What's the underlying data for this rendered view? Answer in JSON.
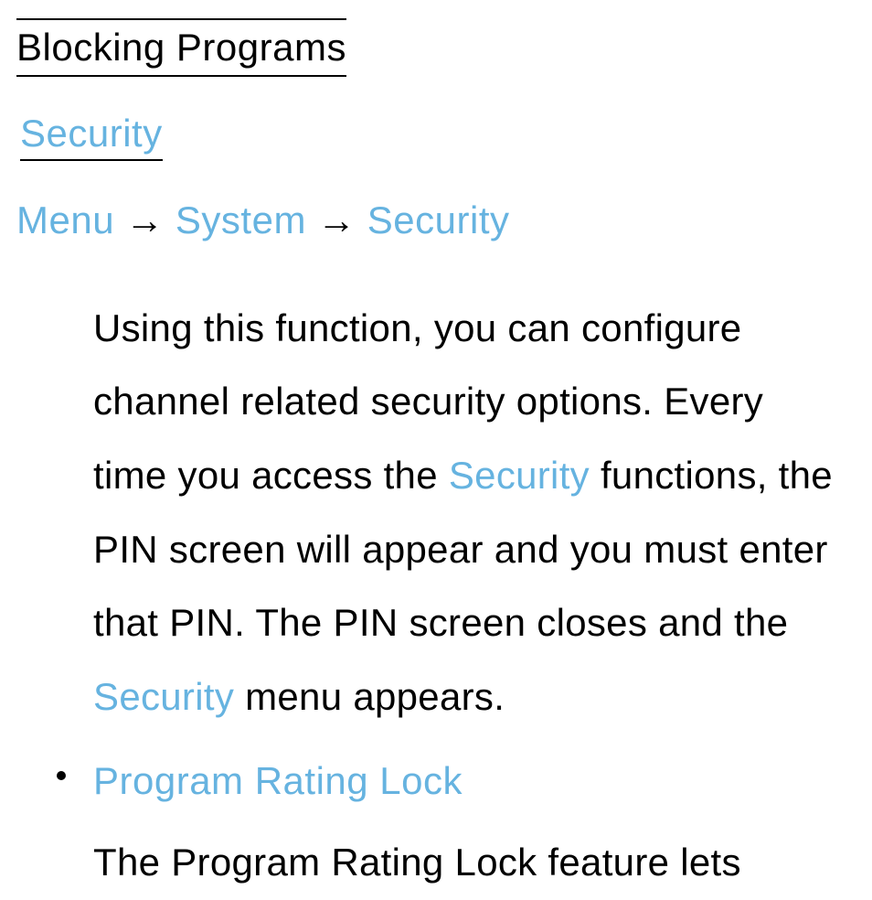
{
  "heading": "Blocking Programs",
  "subheading": "Security",
  "breadcrumb": {
    "item1": "Menu",
    "sep1": " → ",
    "item2": "System",
    "sep2": " → ",
    "item3": "Security"
  },
  "paragraph": {
    "p1a": "Using this function, you can configure channel related security options. Every time you access the ",
    "p1b": "Security",
    "p1c": " functions, the PIN screen will appear and you must enter that PIN. The PIN screen closes and the ",
    "p1d": "Security",
    "p1e": " menu appears."
  },
  "list": {
    "item1": {
      "title": "Program Rating Lock",
      "body": "The Program Rating Lock feature lets"
    }
  }
}
